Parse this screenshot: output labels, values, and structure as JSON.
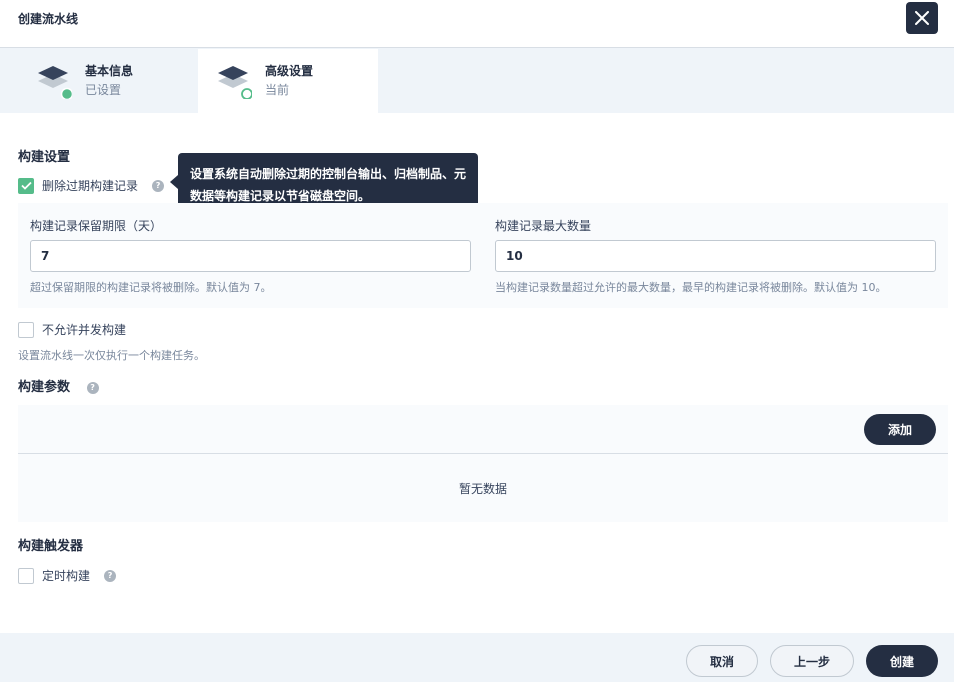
{
  "dialog": {
    "title": "创建流水线",
    "close_icon": "close-icon"
  },
  "tabs": [
    {
      "title": "基本信息",
      "status": "已设置",
      "icon": "layers-icon",
      "state": "done"
    },
    {
      "title": "高级设置",
      "status": "当前",
      "icon": "layers-icon",
      "state": "current"
    }
  ],
  "build_settings": {
    "title": "构建设置",
    "discard_old": {
      "label": "删除过期构建记录",
      "checked": true,
      "tooltip": "设置系统自动删除过期的控制台输出、归档制品、元数据等构建记录以节省磁盘空间。"
    },
    "retention_days": {
      "label": "构建记录保留期限（天）",
      "value": "7",
      "desc": "超过保留期限的构建记录将被删除。默认值为 7。"
    },
    "max_records": {
      "label": "构建记录最大数量",
      "value": "10",
      "desc": "当构建记录数量超过允许的最大数量，最早的构建记录将被删除。默认值为 10。"
    },
    "no_concurrent": {
      "label": "不允许并发构建",
      "checked": false,
      "desc": "设置流水线一次仅执行一个构建任务。"
    }
  },
  "build_params": {
    "title": "构建参数",
    "add_label": "添加",
    "empty_text": "暂无数据"
  },
  "build_triggers": {
    "title": "构建触发器",
    "scheduled": {
      "label": "定时构建",
      "checked": false
    }
  },
  "footer": {
    "cancel_label": "取消",
    "prev_label": "上一步",
    "create_label": "创建"
  },
  "colors": {
    "primary_dark": "#242e42",
    "success_green": "#55bc8a",
    "muted_text": "#79879c",
    "border": "#c1c9d1"
  }
}
